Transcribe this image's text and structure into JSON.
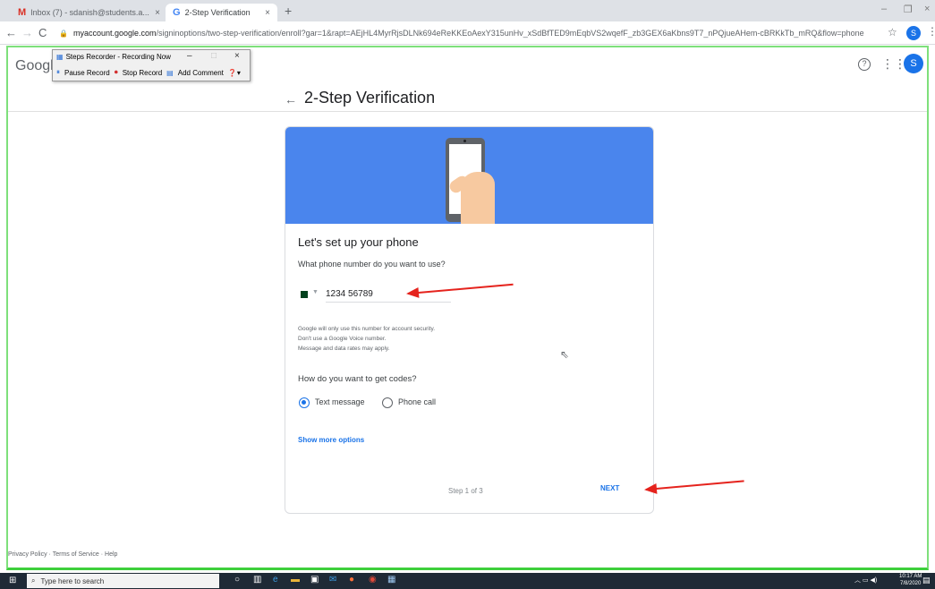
{
  "browser": {
    "tabs": [
      {
        "icon": "M",
        "label": "Inbox (7) - sdanish@students.a...",
        "close": "×"
      },
      {
        "icon": "G",
        "label": "2-Step Verification",
        "close": "×"
      }
    ],
    "new_tab": "+",
    "window_controls": {
      "minimize": "–",
      "restore": "❐",
      "close": "×"
    },
    "url_host": "myaccount.google.com",
    "url_path": "/signinoptions/two-step-verification/enroll?gar=1&rapt=AEjHL4MyrRjsDLNk694eReKKEoAexY315unHv_xSdBfTED9mEqbVS2wqefF_zb3GEX6aKbns9T7_nPQjueAHem-cBRKkTb_mRQ&flow=phone",
    "profile_initial": "S"
  },
  "google_header": {
    "logo": "Google",
    "avatar_initial": "S"
  },
  "steps_recorder": {
    "title": "Steps Recorder - Recording Now",
    "pause": "Pause Record",
    "stop": "Stop Record",
    "comment": "Add Comment"
  },
  "page": {
    "back": "←",
    "title": "2-Step Verification"
  },
  "card": {
    "heading": "Let's set up your phone",
    "question_phone": "What phone number do you want to use?",
    "phone_value": "1234 56789",
    "info_lines": [
      "Google will only use this number for account security.",
      "Don't use a Google Voice number.",
      "Message and data rates may apply."
    ],
    "question_codes": "How do you want to get codes?",
    "option_text": "Text message",
    "option_call": "Phone call",
    "selected_option": "Text message",
    "more_options": "Show more options",
    "step": "Step 1 of 3",
    "next": "NEXT"
  },
  "footer": {
    "privacy": "Privacy Policy",
    "terms": "Terms of Service",
    "help": "Help"
  },
  "taskbar": {
    "search_placeholder": "Type here to search",
    "time": "10:17 AM",
    "date": "7/8/2020"
  },
  "colors": {
    "accent": "#1a73e8",
    "banner": "#4a85ed",
    "annotation": "#e5231d",
    "frame": "#3ecf3c"
  }
}
